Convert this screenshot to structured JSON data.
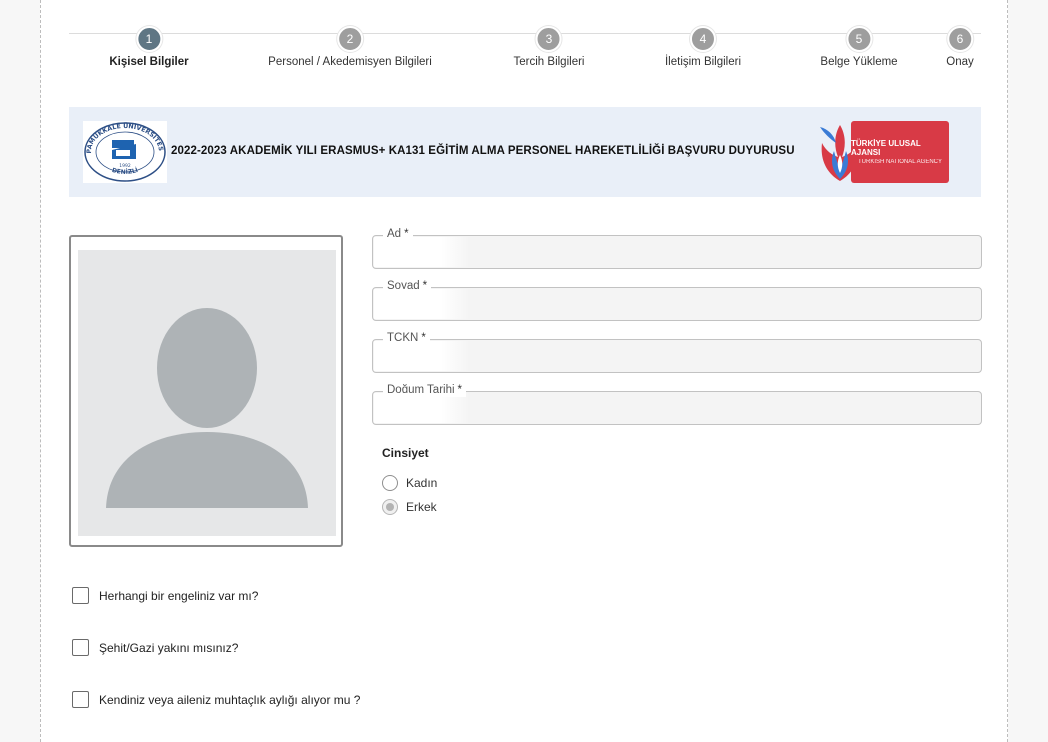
{
  "stepper": {
    "steps": [
      {
        "num": "1",
        "label": "Kişisel Bilgiler"
      },
      {
        "num": "2",
        "label": "Personel / Akedemisyen Bilgileri"
      },
      {
        "num": "3",
        "label": "Tercih Bilgileri"
      },
      {
        "num": "4",
        "label": "İletişim Bilgileri"
      },
      {
        "num": "5",
        "label": "Belge Yükleme"
      },
      {
        "num": "6",
        "label": "Onay"
      }
    ],
    "active_index": 0
  },
  "banner": {
    "title": "2022-2023 AKADEMİK YILI ERASMUS+ KA131 EĞİTİM ALMA PERSONEL HAREKETLİLİĞİ BAŞVURU DUYURUSU",
    "uni_logo_top": "PAMUKKALE ÜNİVERSİTESİ",
    "uni_logo_year": "1992",
    "uni_logo_bottom": "DENİZLİ",
    "agency_name": "TÜRKİYE ULUSAL AJANSI",
    "agency_sub": "TURKISH NATIONAL AGENCY"
  },
  "form": {
    "fields": [
      {
        "label": "Ad",
        "required": "*",
        "value": ""
      },
      {
        "label": "Soyad",
        "required": "*",
        "value": ""
      },
      {
        "label": "TCKN",
        "required": "*",
        "value": ""
      },
      {
        "label": "Doğum Tarihi",
        "required": "*",
        "value": ""
      }
    ],
    "gender": {
      "title": "Cinsiyet",
      "options": [
        {
          "label": "Kadın",
          "checked": false
        },
        {
          "label": "Erkek",
          "checked": true
        }
      ]
    },
    "checkboxes": [
      {
        "label": "Herhangi bir engeliniz var mı?",
        "checked": false
      },
      {
        "label": "Şehit/Gazi yakını mısınız?",
        "checked": false
      },
      {
        "label": "Kendiniz veya aileniz muhtaçlık aylığı alıyor mu ?",
        "checked": false
      }
    ]
  },
  "colors": {
    "active_step": "#5f7684",
    "inactive_step": "#9e9e9e",
    "banner_bg": "#e9eff8",
    "agency_red": "#d83a46",
    "uni_blue": "#1e63b0"
  },
  "icons": {
    "avatar": "user-silhouette-icon"
  }
}
